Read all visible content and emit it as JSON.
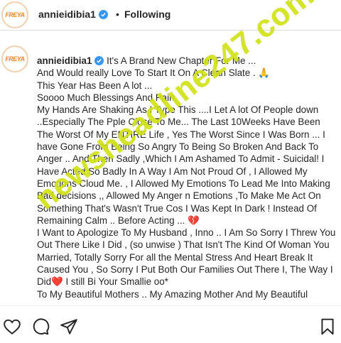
{
  "header": {
    "username": "annieidibia1",
    "separator": "•",
    "follow_status": "Following"
  },
  "avatar_logo_text": "FREYA",
  "caption": {
    "username": "annieidibia1",
    "lines": [
      "It's A Brand New Chapter For Me ...",
      "And Would really Love To Start It On A Clean Slate . 🙏",
      "This Year Has Been A lot ...",
      "Soooo Much Blessings And Pain.",
      "My Hands Are Shaking As I Type This ....I Let A lot Of People down ..Especially The Pple Close To Me... The Last 10Weeks Have Been The Worst Of My ENTIRE Life , Yes The Worst Since I Was Born ... I have Gone From Being So Angry To Being So Broken And Back To Anger .. And Then Sadly ,Which I Am Ashamed To Admit - Suicidal! I Have Acted So Badly In A Way I Am Not Proud Of , I Allowed My Emotions Cloud Me. , I Allowed My Emotions To Lead Me Into Making Bad decisions ,, Allowed My Anger n Emotions ,To Make Me Act On Something That's Wasn't True Cos I Was Kept In Dark ! Instead Of Remaining Calm .. Before Acting ... 💔",
      "I Want to Apologize To My Husband , Inno .. I Am So Sorry I Threw You Out There Like I Did , (so unwise ) That Isn't The Kind Of Woman You Married, Totally Sorry For all the Mental Stress And Heart Break It Caused You , So Sorry I Put Both Our Families Out There I, The Way I Did❤️ I still Bi Your Smallie oo*",
      "To My Beautiful Mothers .. My Amazing Mother And My Beautiful"
    ]
  },
  "watermark": "newsheadline247.com",
  "icons": {
    "like": "heart-outline-icon",
    "comment": "comment-icon",
    "share": "paper-plane-icon",
    "save": "bookmark-icon",
    "verified": "verified-badge-icon"
  },
  "colors": {
    "verified": "#3897f0",
    "text": "#262626",
    "watermark": "#d6e914",
    "heart": "#d41b2c"
  }
}
